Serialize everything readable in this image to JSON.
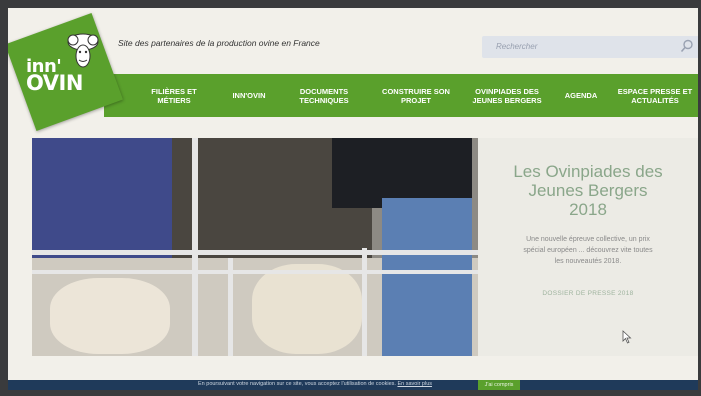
{
  "site": {
    "logo_line1": "inn'",
    "logo_line2": "OVIN",
    "tagline": "Site des partenaires de la production ovine en France"
  },
  "search": {
    "placeholder": "Rechercher"
  },
  "nav": {
    "items": [
      {
        "label": "FILIÈRES ET MÉTIERS"
      },
      {
        "label": "INN'OVIN"
      },
      {
        "label": "DOCUMENTS TECHNIQUES"
      },
      {
        "label": "CONSTRUIRE SON PROJET"
      },
      {
        "label": "OVINPIADES DES JEUNES BERGERS"
      },
      {
        "label": "AGENDA"
      },
      {
        "label": "ESPACE PRESSE ET ACTUALITÉS"
      }
    ]
  },
  "hero": {
    "title_line1": "Les Ovinpiades des",
    "title_line2": "Jeunes Bergers",
    "title_line3": "2018",
    "text_line1": "Une nouvelle épreuve collective, un prix",
    "text_line2": "spécial européen ... découvrez vite toutes",
    "text_line3": "les nouveautés 2018.",
    "link": "DOSSIER DE PRESSE 2018"
  },
  "cookie": {
    "text": "En poursuivant votre navigation sur ce site, vous acceptez l'utilisation de cookies.",
    "link": "En savoir plus",
    "button": "J'ai compris"
  },
  "colors": {
    "brand_green": "#5aa02c",
    "cookie_bar": "#1f3a5a",
    "hero_title": "#8aa68a"
  }
}
